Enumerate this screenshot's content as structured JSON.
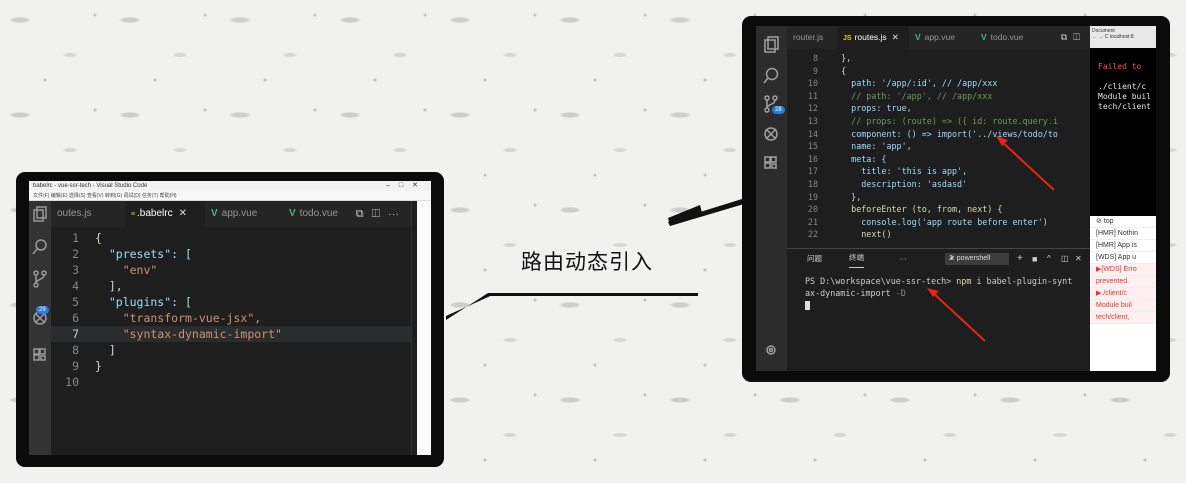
{
  "left": {
    "window_title": "babelrc - vue-ssr-tech - Visual Studio Code",
    "menu": "文件(F)  编辑(E)  选择(S)  查看(V)  转到(G)  调试(D)  任务(T)  帮助(H)",
    "tabs": [
      "outes.js",
      ".babelrc",
      "app.vue",
      "todo.vue"
    ],
    "active_tab": ".babelrc",
    "badge": "29",
    "line_numbers": [
      "1",
      "2",
      "3",
      "4",
      "5",
      "6",
      "7",
      "8",
      "9",
      "10"
    ],
    "code": [
      "{",
      "  \"presets\": [",
      "    \"env\"",
      "  ],",
      "  \"plugins\": [",
      "    \"transform-vue-jsx\",",
      "    \"syntax-dynamic-import\"",
      "  ]",
      "}",
      ""
    ]
  },
  "callout": {
    "label": "路由动态引入"
  },
  "right": {
    "tabs": [
      "router.js",
      "routes.js",
      "app.vue",
      "todo.vue"
    ],
    "active_tab": "routes.js",
    "badge": "28",
    "line_numbers": [
      "8",
      "9",
      "10",
      "11",
      "12",
      "13",
      "14",
      "15",
      "16",
      "17",
      "18",
      "19",
      "20",
      "21",
      "22"
    ],
    "code": [
      "  },",
      "  {",
      "    path: '/app/:id', // /app/xxx",
      "    // path: '/app', // /app/xxx",
      "    props: true,",
      "    // props: (route) => ({ id: route.query.i",
      "    component: () => import('../views/todo/to",
      "    name: 'app',",
      "    meta: {",
      "      title: 'this is app',",
      "      description: 'asdasd'",
      "    },",
      "    beforeEnter (to, from, next) {",
      "      console.log('app route before enter')",
      "      next()"
    ],
    "panel": {
      "tab_problems": "问题",
      "tab_terminal": "终端",
      "more": "···",
      "terminal_select": "2: powershell",
      "prompt": "PS D:\\workspace\\vue-ssr-tech> ",
      "command": "npm",
      "args": " i babel-plugin-synt",
      "args_wrap": "ax-dynamic-import",
      "flag": " -D"
    },
    "browser": {
      "tab": "Document",
      "url": "localhost:8",
      "error_title": "Failed to",
      "error_lines": [
        "./client/c",
        "Module buil",
        "tech/client"
      ],
      "filter": "top",
      "console": [
        "[HMR] Nothin",
        "[HMR] App is",
        "[WDS] App u",
        "▶[WDS] Erro",
        "prevented.",
        "▶./client/c",
        "Module buil",
        "tech/client,"
      ]
    }
  }
}
